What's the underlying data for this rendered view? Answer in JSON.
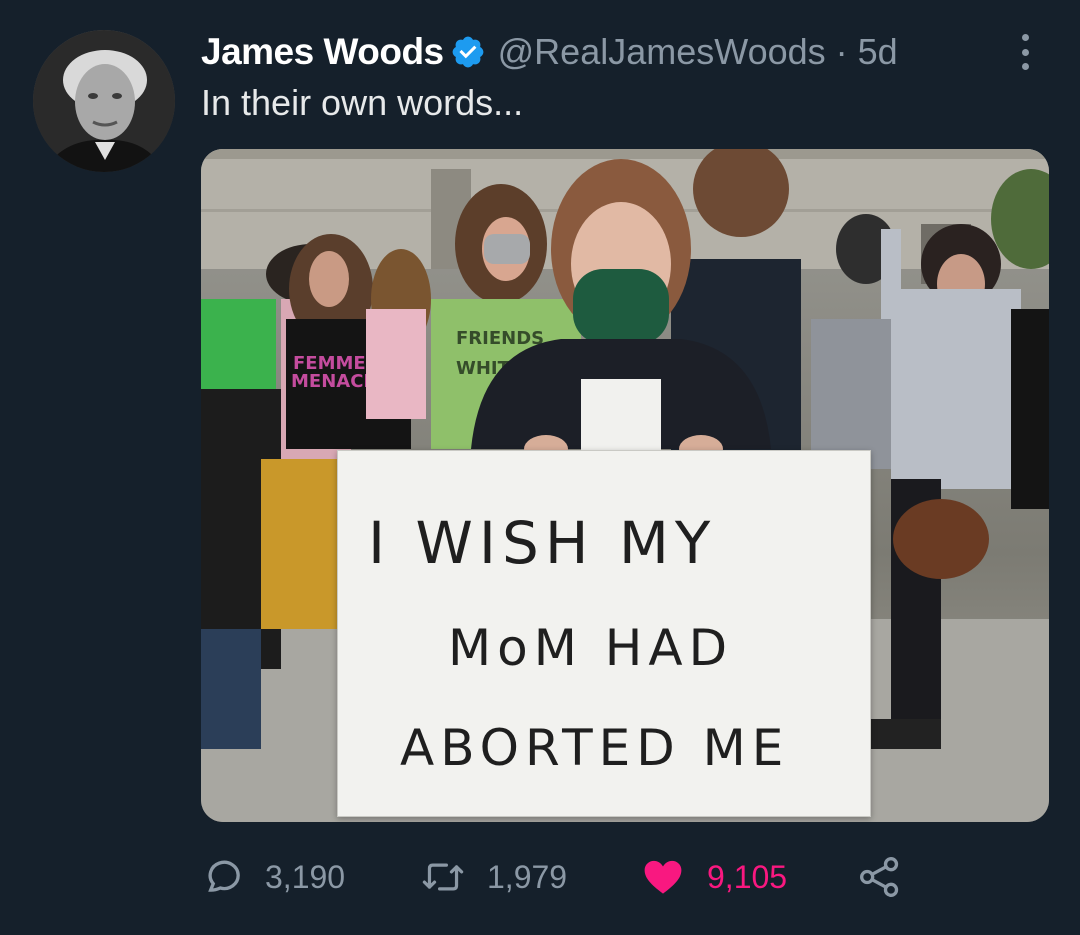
{
  "tweet": {
    "author": {
      "display_name": "James Woods",
      "handle": "@RealJamesWoods",
      "verified": true,
      "avatar_icon": "profile-photo"
    },
    "separator": "·",
    "time_ago": "5d",
    "text": "In their own words...",
    "media": {
      "type": "photo",
      "sign_text": {
        "line1": "I WISH MY",
        "line2": "MoM HAD",
        "line3": "ABORTED ME"
      },
      "shirt_texts": [
        "FEMME MENACE",
        "BROS 39 FRIENDS WHITE"
      ]
    },
    "stats": {
      "replies": "3,190",
      "retweets": "1,979",
      "likes": "9,105"
    },
    "liked": true,
    "colors": {
      "background": "#15202b",
      "secondary_text": "#8b98a5",
      "like_pink": "#f91880",
      "verified_blue": "#1d9bf0"
    },
    "icons": {
      "reply": "reply-icon",
      "retweet": "retweet-icon",
      "like": "heart-icon",
      "share": "share-icon",
      "more": "more-vertical-icon"
    }
  }
}
